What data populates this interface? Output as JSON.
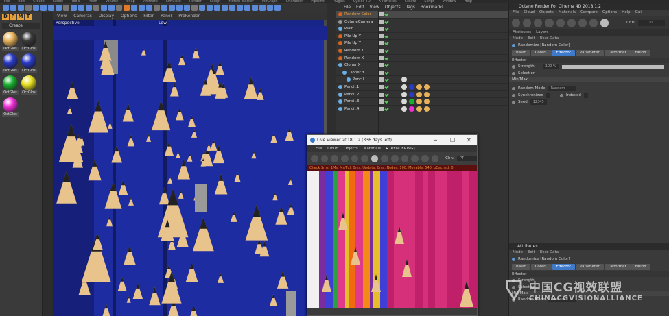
{
  "top_menu": [
    "File",
    "Edit",
    "Create",
    "Select",
    "Tools",
    "Mesh",
    "Volume",
    "Snap",
    "Animate",
    "Simulate",
    "Render",
    "Sculpt",
    "Motion Tracker",
    "MoGraph",
    "Character",
    "Pipeline",
    "Plugins",
    "Cycles 4D",
    "X-Particles",
    "Create",
    "Script",
    "Window",
    "Help"
  ],
  "layout_label": "Layout:",
  "material_manager": {
    "tabs": [
      "D",
      "P",
      "M",
      "T"
    ],
    "create_label": "Create",
    "materials": [
      {
        "label": "OctGlos",
        "color": "#e8b25a"
      },
      {
        "label": "OctGlos",
        "color": "#3a3a3a"
      },
      {
        "label": "OctGlos",
        "color": "#2a3ac8"
      },
      {
        "label": "OctGlos",
        "color": "#2a3ac8"
      },
      {
        "label": "OctGlos",
        "color": "#18b030"
      },
      {
        "label": "OctGlos",
        "color": "#e6e020"
      },
      {
        "label": "OctGlos",
        "color": "#ee30d8"
      }
    ]
  },
  "viewport": {
    "menu": [
      "View",
      "Cameras",
      "Display",
      "Options",
      "Filter",
      "Panel",
      "ProRender"
    ],
    "camera_label": "Perspective",
    "quality_label": "Low"
  },
  "object_manager": {
    "menu": [
      "File",
      "Edit",
      "View",
      "Objects",
      "Tags",
      "Bookmarks"
    ],
    "objects": [
      {
        "name": "Random Color",
        "indent": 0,
        "selected": true,
        "icon_color": "#d8641c"
      },
      {
        "name": "OctaneCamera",
        "indent": 0,
        "selected": false,
        "icon_color": "#999999"
      },
      {
        "name": "Plain",
        "indent": 0,
        "selected": false,
        "icon_color": "#6ab0e8"
      },
      {
        "name": "Pile Up Y",
        "indent": 0,
        "selected": false,
        "icon_color": "#d8641c"
      },
      {
        "name": "Pile Up Y",
        "indent": 0,
        "selected": false,
        "icon_color": "#d8641c"
      },
      {
        "name": "Random Y",
        "indent": 0,
        "selected": false,
        "icon_color": "#d8641c"
      },
      {
        "name": "Random X",
        "indent": 0,
        "selected": false,
        "icon_color": "#d8641c"
      },
      {
        "name": "Cloner X",
        "indent": 0,
        "selected": false,
        "icon_color": "#6ab0e8"
      },
      {
        "name": "Cloner Y",
        "indent": 1,
        "selected": false,
        "icon_color": "#6ab0e8"
      },
      {
        "name": "Pencil",
        "indent": 2,
        "selected": false,
        "icon_color": "#6ab0e8"
      },
      {
        "name": "Pencil.1",
        "indent": 0,
        "selected": false,
        "icon_color": "#6ab0e8"
      },
      {
        "name": "Pencil.2",
        "indent": 0,
        "selected": false,
        "icon_color": "#6ab0e8"
      },
      {
        "name": "Pencil.3",
        "indent": 0,
        "selected": false,
        "icon_color": "#6ab0e8"
      },
      {
        "name": "Pencil.4",
        "indent": 0,
        "selected": false,
        "icon_color": "#6ab0e8"
      }
    ]
  },
  "attributes_top": {
    "title": "Octane Render For Cinema 4D 2018.1.2",
    "top_menu": [
      "File",
      "Cloud",
      "Objects",
      "Materials",
      "Compare",
      "Options",
      "Help",
      "Gui"
    ],
    "chn_label": "Chn:",
    "chn_value": "PT",
    "tabs_hdr": [
      "Attributes",
      "Layers"
    ],
    "menu": [
      "Mode",
      "Edit",
      "User Data"
    ],
    "object_title": "Randomize [Random Color]",
    "tabs": [
      "Basic",
      "Coord.",
      "Effector",
      "Parameter",
      "Deformer",
      "Falloff"
    ],
    "active_tab": "Effector",
    "section": "Effector",
    "strength_label": "Strength",
    "strength_value": "100 %",
    "selection_label": "Selection",
    "minmax_label": "Min/Max",
    "random_mode_label": "Random Mode",
    "random_mode_value": "Random",
    "synchronized_label": "Synchronized",
    "indexed_label": "Indexed",
    "seed_label": "Seed",
    "seed_value": "12345"
  },
  "attributes_bottom": {
    "header": "Attributes",
    "menu": [
      "Mode",
      "Edit",
      "User Data"
    ],
    "object_title": "Randomize [Random Color]",
    "tabs": [
      "Basic",
      "Coord.",
      "Effector",
      "Parameter",
      "Deformer",
      "Falloff"
    ],
    "active_tab": "Effector",
    "section": "Effector",
    "strength_label": "Strength",
    "selection_label": "Selection",
    "minmax_label": "Min/Max",
    "random_mode_label": "Random Mode",
    "random_mode_value": "Random"
  },
  "live_viewer": {
    "title": "Live Viewer 2018.1.2 (336 days left)",
    "menu": [
      "File",
      "Cloud",
      "Objects",
      "Materials"
    ],
    "render_state": "[RENDERING]",
    "chn_label": "Chn:",
    "chn_value": "PT",
    "status": "Check Sms: 1Ms, Ms/Pxl: 0ms, Update: 0ms, Nodes: 100, Movable: 540, bCached: 0",
    "pencil_colors": [
      "#f06a10",
      "#f28a18",
      "#7a2ca0",
      "#3f3fd8",
      "#2ca040",
      "#e6bd2a",
      "#e23a8a",
      "#c8306a",
      "#f4f4f4"
    ]
  },
  "watermark": {
    "line1": "中国CG视效联盟",
    "line2": "CHINACGVISIONALLIANCE"
  }
}
